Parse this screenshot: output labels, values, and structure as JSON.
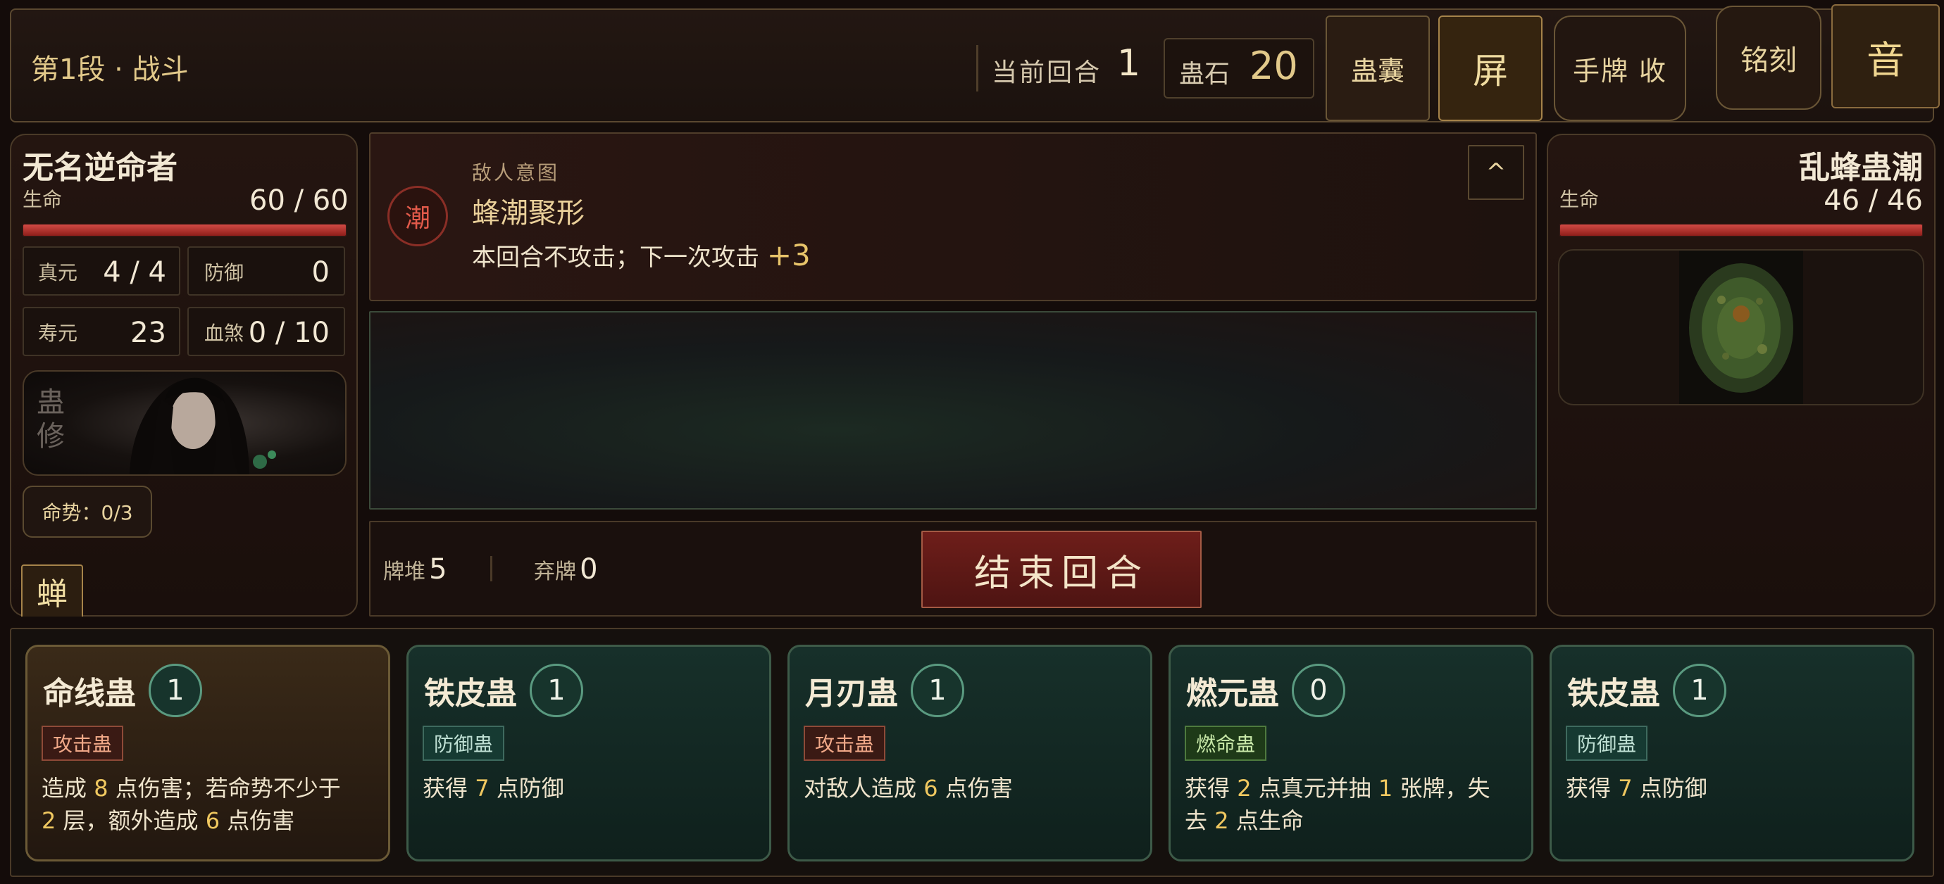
{
  "header": {
    "stage": "第1段 · 战斗",
    "turn_label": "当前回合",
    "turn_value": "1",
    "gustone_label": "蛊石",
    "gustone_value": "20",
    "btn_pouch": "蛊囊",
    "btn_screen": "屏",
    "btn_hand": "手牌 收",
    "btn_engrave": "铭刻",
    "btn_sound": "音"
  },
  "player": {
    "name": "无名逆命者",
    "hp_label": "生命",
    "hp_text": "60 / 60",
    "hp_fraction": 1.0,
    "zhenyuan_label": "真元",
    "zhenyuan_value": "4 / 4",
    "defense_label": "防御",
    "defense_value": "0",
    "shouyuan_label": "寿元",
    "shouyuan_value": "23",
    "xuesha_label": "血煞",
    "xuesha_value": "0 / 10",
    "portrait_glyphs": "蛊修",
    "mingshi": "命势：0/3",
    "chan": "蝉"
  },
  "intent": {
    "icon": "潮",
    "label": "敌人意图",
    "name": "蜂潮聚形",
    "desc": "本回合不攻击；下一次攻击",
    "plus": "+3",
    "collapse": "^"
  },
  "piles": {
    "draw_label": "牌堆",
    "draw_value": "5",
    "discard_label": "弃牌",
    "discard_value": "0",
    "end_turn": "结束回合"
  },
  "enemy": {
    "name": "乱蜂蛊潮",
    "hp_label": "生命",
    "hp_text": "46 / 46",
    "hp_fraction": 1.0
  },
  "hand": [
    {
      "name": "命线蛊",
      "cost": "1",
      "tag": "攻击蛊",
      "desc1": [
        "造成 ",
        "8",
        " 点伤害；若命势不少于"
      ],
      "desc2": [
        "2",
        " 层，额外造成 ",
        "6",
        " 点伤害"
      ]
    },
    {
      "name": "铁皮蛊",
      "cost": "1",
      "tag": "防御蛊",
      "desc1": [
        "获得 ",
        "7",
        " 点防御"
      ]
    },
    {
      "name": "月刃蛊",
      "cost": "1",
      "tag": "攻击蛊",
      "desc1": [
        "对敌人造成 ",
        "6",
        " 点伤害"
      ]
    },
    {
      "name": "燃元蛊",
      "cost": "0",
      "tag": "燃命蛊",
      "desc1": [
        "获得 ",
        "2",
        " 点真元并抽 ",
        "1",
        " 张牌，失"
      ],
      "desc2": [
        "去 ",
        "2",
        " 点生命"
      ]
    },
    {
      "name": "铁皮蛊",
      "cost": "1",
      "tag": "防御蛊",
      "desc1": [
        "获得 ",
        "7",
        " 点防御"
      ]
    }
  ],
  "colors": {
    "accent_gold": "#e2c98a",
    "hp_red": "#c8403a",
    "number_gold": "#f0c860",
    "card_border": "#3d5a48"
  }
}
